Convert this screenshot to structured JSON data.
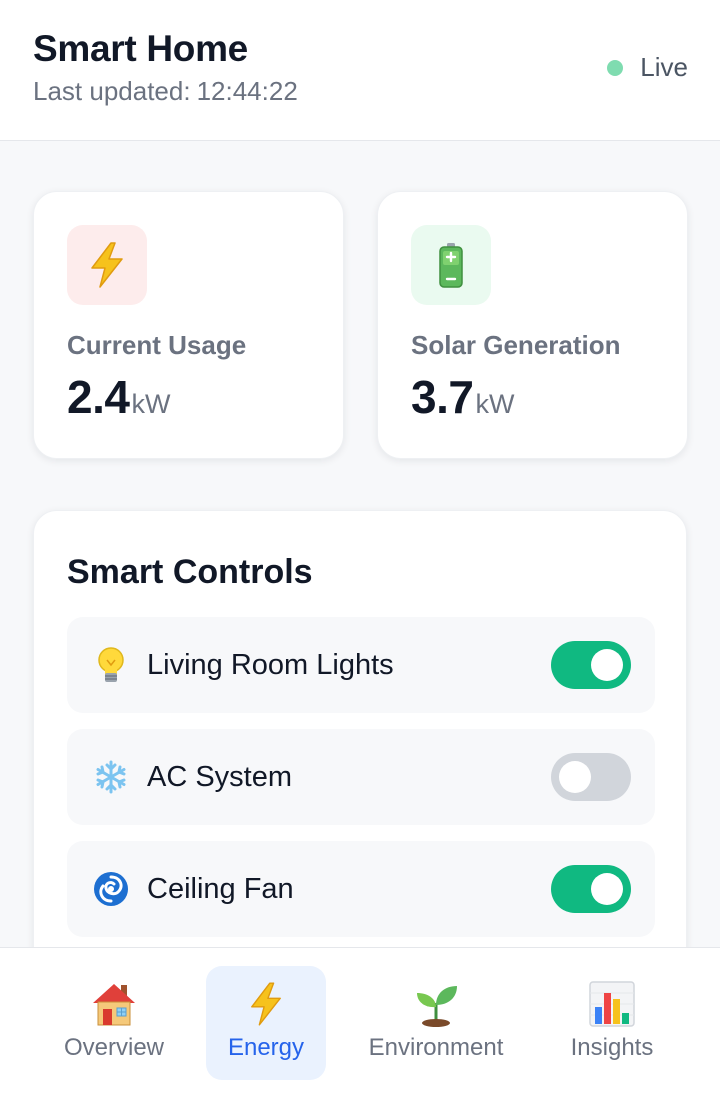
{
  "header": {
    "title": "Smart Home",
    "updated_prefix": "Last updated:",
    "updated_time": "12:44:22",
    "status_label": "Live",
    "status_color": "#7fdcb0"
  },
  "stats": [
    {
      "label": "Current Usage",
      "value": "2.4",
      "unit": "kW",
      "icon": "lightning-icon"
    },
    {
      "label": "Solar Generation",
      "value": "3.7",
      "unit": "kW",
      "icon": "battery-icon"
    }
  ],
  "controls": {
    "title": "Smart Controls",
    "items": [
      {
        "label": "Living Room Lights",
        "icon": "lightbulb-icon",
        "on": true
      },
      {
        "label": "AC System",
        "icon": "snowflake-icon",
        "on": false
      },
      {
        "label": "Ceiling Fan",
        "icon": "cyclone-fan-icon",
        "on": true
      }
    ]
  },
  "nav": {
    "items": [
      {
        "label": "Overview",
        "icon": "house-icon",
        "active": false
      },
      {
        "label": "Energy",
        "icon": "lightning-icon",
        "active": true
      },
      {
        "label": "Environment",
        "icon": "seedling-icon",
        "active": false
      },
      {
        "label": "Insights",
        "icon": "bar-chart-icon",
        "active": false
      }
    ]
  },
  "colors": {
    "accent": "#10b981",
    "active_nav": "#2563eb",
    "toggle_off": "#d1d5db"
  }
}
